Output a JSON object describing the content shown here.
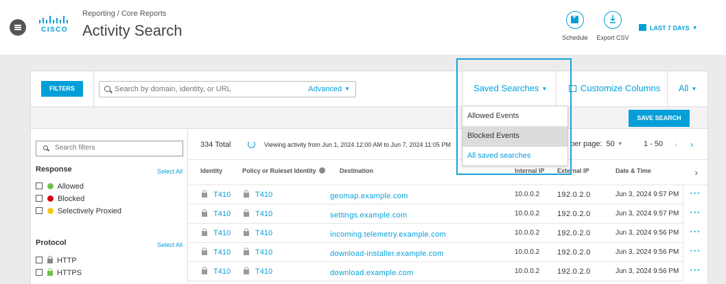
{
  "header": {
    "logo_text": "CISCO",
    "breadcrumb": "Reporting / Core Reports",
    "title": "Activity Search",
    "actions": {
      "schedule": "Schedule",
      "export": "Export CSV"
    },
    "date_range": "LAST 7 DAYS"
  },
  "toolbar": {
    "filters": "FILTERS",
    "search_placeholder": "Search by domain, identity, or URL",
    "advanced": "Advanced",
    "saved_searches": "Saved Searches",
    "customize_columns": "Customize Columns",
    "all": "All",
    "save_search": "SAVE SEARCH"
  },
  "saved_dropdown": {
    "items": [
      "Allowed Events",
      "Blocked Events",
      "All saved searches"
    ],
    "highlighted": "Blocked Events"
  },
  "filters": {
    "search_placeholder": "Search filters",
    "response": {
      "heading": "Response",
      "select_all": "Select All",
      "items": [
        "Allowed",
        "Blocked",
        "Selectively Proxied"
      ],
      "colors": [
        "#6cc04a",
        "#d0021b",
        "#f5c518"
      ]
    },
    "protocol": {
      "heading": "Protocol",
      "select_all": "Select All",
      "items": [
        "HTTP",
        "HTTPS"
      ]
    }
  },
  "summary": {
    "total": "334 Total",
    "viewing": "Viewing activity from Jun 1, 2024 12:00 AM to Jun 7, 2024 11:05 PM",
    "per_page_label": "lts per page:",
    "per_page_value": "50",
    "range": "1 - 50"
  },
  "table": {
    "headers": {
      "identity": "Identity",
      "policy": "Policy or Ruleset Identity",
      "destination": "Destination",
      "internal_ip": "Internal IP",
      "external_ip": "External IP",
      "datetime": "Date & Time"
    },
    "rows": [
      {
        "identity": "T410",
        "policy": "T410",
        "destination": "geomap.example.com",
        "internal_ip": "10.0.0.2",
        "external_ip": "192.0.2.0",
        "datetime": "Jun 3, 2024 9:57 PM"
      },
      {
        "identity": "T410",
        "policy": "T410",
        "destination": "settings.example.com",
        "internal_ip": "10.0.0.2",
        "external_ip": "192.0.2.0",
        "datetime": "Jun 3, 2024 9:57 PM"
      },
      {
        "identity": "T410",
        "policy": "T410",
        "destination": "incoming.telemetry.example.com",
        "internal_ip": "10.0.0.2",
        "external_ip": "192.0.2.0",
        "datetime": "Jun 3, 2024 9:56 PM"
      },
      {
        "identity": "T410",
        "policy": "T410",
        "destination": "download-installer.example.com",
        "internal_ip": "10.0.0.2",
        "external_ip": "192.0.2.0",
        "datetime": "Jun 3, 2024 9:56 PM"
      },
      {
        "identity": "T410",
        "policy": "T410",
        "destination": "download.example.com",
        "internal_ip": "10.0.0.2",
        "external_ip": "192.0.2.0",
        "datetime": "Jun 3, 2024 9:56 PM"
      }
    ],
    "more": "···"
  },
  "colors": {
    "accent": "#049fd9"
  }
}
